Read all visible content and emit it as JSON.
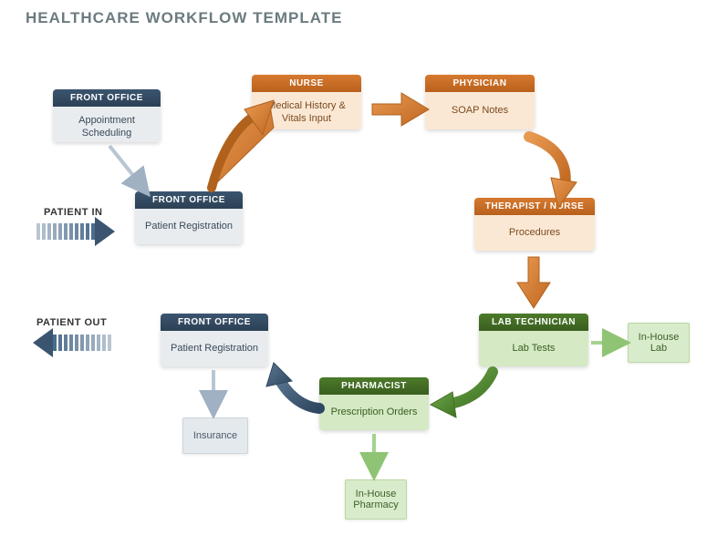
{
  "title": "HEALTHCARE WORKFLOW TEMPLATE",
  "labels": {
    "patient_in": "PATIENT IN",
    "patient_out": "PATIENT OUT"
  },
  "nodes": {
    "front_office_1": {
      "header": "FRONT OFFICE",
      "body": "Appointment Scheduling"
    },
    "front_office_2": {
      "header": "FRONT OFFICE",
      "body": "Patient Registration"
    },
    "nurse": {
      "header": "NURSE",
      "body": "Medical History & Vitals Input"
    },
    "physician": {
      "header": "PHYSICIAN",
      "body": "SOAP Notes"
    },
    "therapist": {
      "header": "THERAPIST / NURSE",
      "body": "Procedures"
    },
    "lab_tech": {
      "header": "LAB TECHNICIAN",
      "body": "Lab Tests"
    },
    "pharmacist": {
      "header": "PHARMACIST",
      "body": "Prescription Orders"
    },
    "front_office_3": {
      "header": "FRONT OFFICE",
      "body": "Patient Registration"
    }
  },
  "simple": {
    "in_house_lab": "In-House Lab",
    "in_house_pharmacy": "In-House Pharmacy",
    "insurance": "Insurance"
  }
}
